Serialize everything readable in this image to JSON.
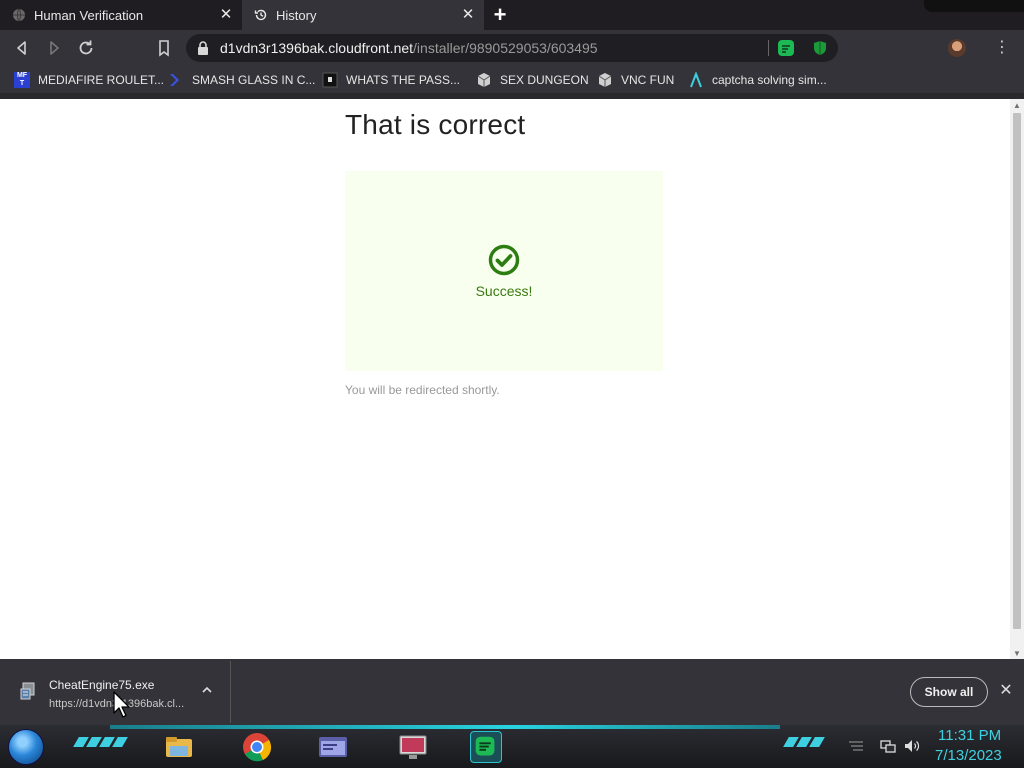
{
  "tabs": [
    {
      "title": "Human Verification",
      "active": false
    },
    {
      "title": "History",
      "active": true
    }
  ],
  "toolbar": {
    "url_host": "d1vdn3r1396bak.cloudfront.net",
    "url_path": "/installer/9890529053/603495"
  },
  "bookmarks": [
    {
      "label": "MEDIAFIRE ROULET...",
      "icon": "mediafire-icon"
    },
    {
      "label": "SMASH GLASS IN C...",
      "icon": "chevron-logo-icon"
    },
    {
      "label": "WHATS THE PASS...",
      "icon": "square-logo-icon"
    },
    {
      "label": "SEX DUNGEON",
      "icon": "cube-icon"
    },
    {
      "label": "VNC FUN",
      "icon": "cube-icon"
    },
    {
      "label": "captcha solving sim...",
      "icon": "lambda-icon"
    }
  ],
  "page": {
    "heading": "That is correct",
    "success_text": "Success!",
    "redirect_text": "You will be redirected shortly."
  },
  "download": {
    "filename": "CheatEngine75.exe",
    "url": "https://d1vdn3r1396bak.cl...",
    "show_all": "Show all"
  },
  "taskbar": {
    "time": "11:31 PM",
    "date": "7/13/2023"
  },
  "colors": {
    "success_green": "#2e7d12",
    "success_bg": "#f8ffef",
    "accent_cyan": "#3fd0e0"
  }
}
